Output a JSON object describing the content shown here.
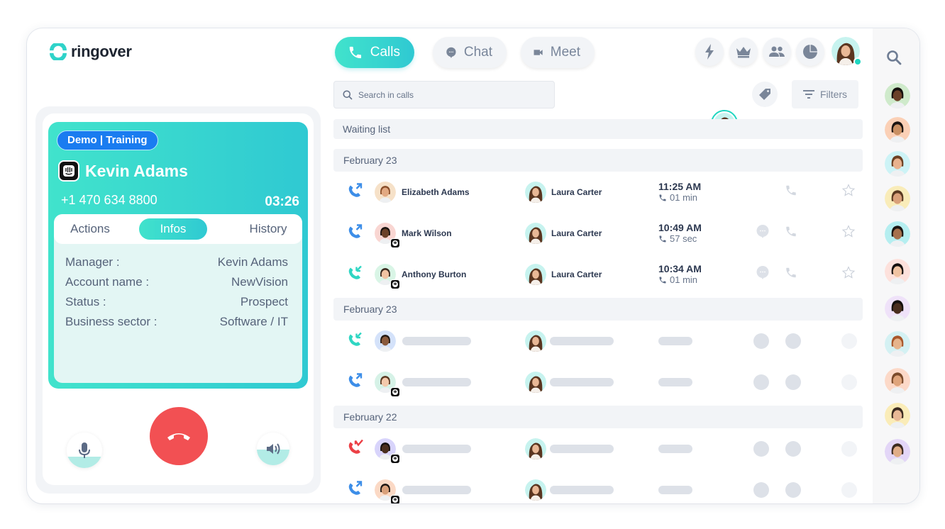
{
  "brand": {
    "name": "ringover",
    "accent": "#2fc9d2",
    "accent_start": "#41e3cc",
    "danger": "#f25053",
    "link_blue": "#1a7cf0"
  },
  "nav": {
    "tabs": [
      {
        "label": "Calls",
        "icon": "phone-icon",
        "active": true
      },
      {
        "label": "Chat",
        "icon": "chat-bubble-icon",
        "active": false
      },
      {
        "label": "Meet",
        "icon": "video-camera-icon",
        "active": false
      }
    ],
    "top_icons": [
      "flash-icon",
      "crown-icon",
      "team-icon",
      "pie-chart-icon"
    ],
    "user_status": "online"
  },
  "search": {
    "placeholder": "Search in calls",
    "value": ""
  },
  "filters": {
    "label": "Filters",
    "tag_icon": "tag-icon"
  },
  "current_call": {
    "tag": "Demo | Training",
    "contact_name": "Kevin Adams",
    "integration_icon": "intercom-icon",
    "phone": "+1 470 634 8800",
    "timer": "03:26",
    "tabs": [
      {
        "label": "Actions",
        "active": false
      },
      {
        "label": "Infos",
        "active": true
      },
      {
        "label": "History",
        "active": false
      }
    ],
    "info": [
      {
        "label": "Manager :",
        "value": "Kevin Adams"
      },
      {
        "label": "Account name :",
        "value": "NewVision"
      },
      {
        "label": "Status :",
        "value": "Prospect"
      },
      {
        "label": "Business sector :",
        "value": "Software / IT"
      }
    ],
    "controls": {
      "mute": "microphone-icon",
      "hangup": "hang-up-icon",
      "speaker": "speaker-icon"
    }
  },
  "list": {
    "waiting_list_label": "Waiting list",
    "groups": [
      {
        "date": "February 23",
        "rows": [
          {
            "direction": "outgoing",
            "caller": "Elizabeth Adams",
            "agent": "Laura Carter",
            "time": "11:25 AM",
            "duration": "01 min",
            "has_message": false,
            "starred": false,
            "intercom": false
          },
          {
            "direction": "outgoing",
            "caller": "Mark Wilson",
            "agent": "Laura Carter",
            "time": "10:49 AM",
            "duration": "57 sec",
            "has_message": true,
            "starred": false,
            "intercom": true
          },
          {
            "direction": "incoming",
            "caller": "Anthony Burton",
            "agent": "Laura Carter",
            "time": "10:34 AM",
            "duration": "01 min",
            "has_message": true,
            "starred": false,
            "intercom": true
          }
        ]
      },
      {
        "date": "February 23",
        "rows": [
          {
            "direction": "incoming",
            "loading": true,
            "intercom": false
          },
          {
            "direction": "outgoing",
            "loading": true,
            "intercom": true
          }
        ]
      },
      {
        "date": "February 22",
        "rows": [
          {
            "direction": "missed",
            "loading": true,
            "intercom": true
          },
          {
            "direction": "outgoing",
            "loading": true,
            "intercom": true
          }
        ]
      }
    ]
  },
  "rail": {
    "search_icon": "search-icon",
    "contact_count": 11
  }
}
